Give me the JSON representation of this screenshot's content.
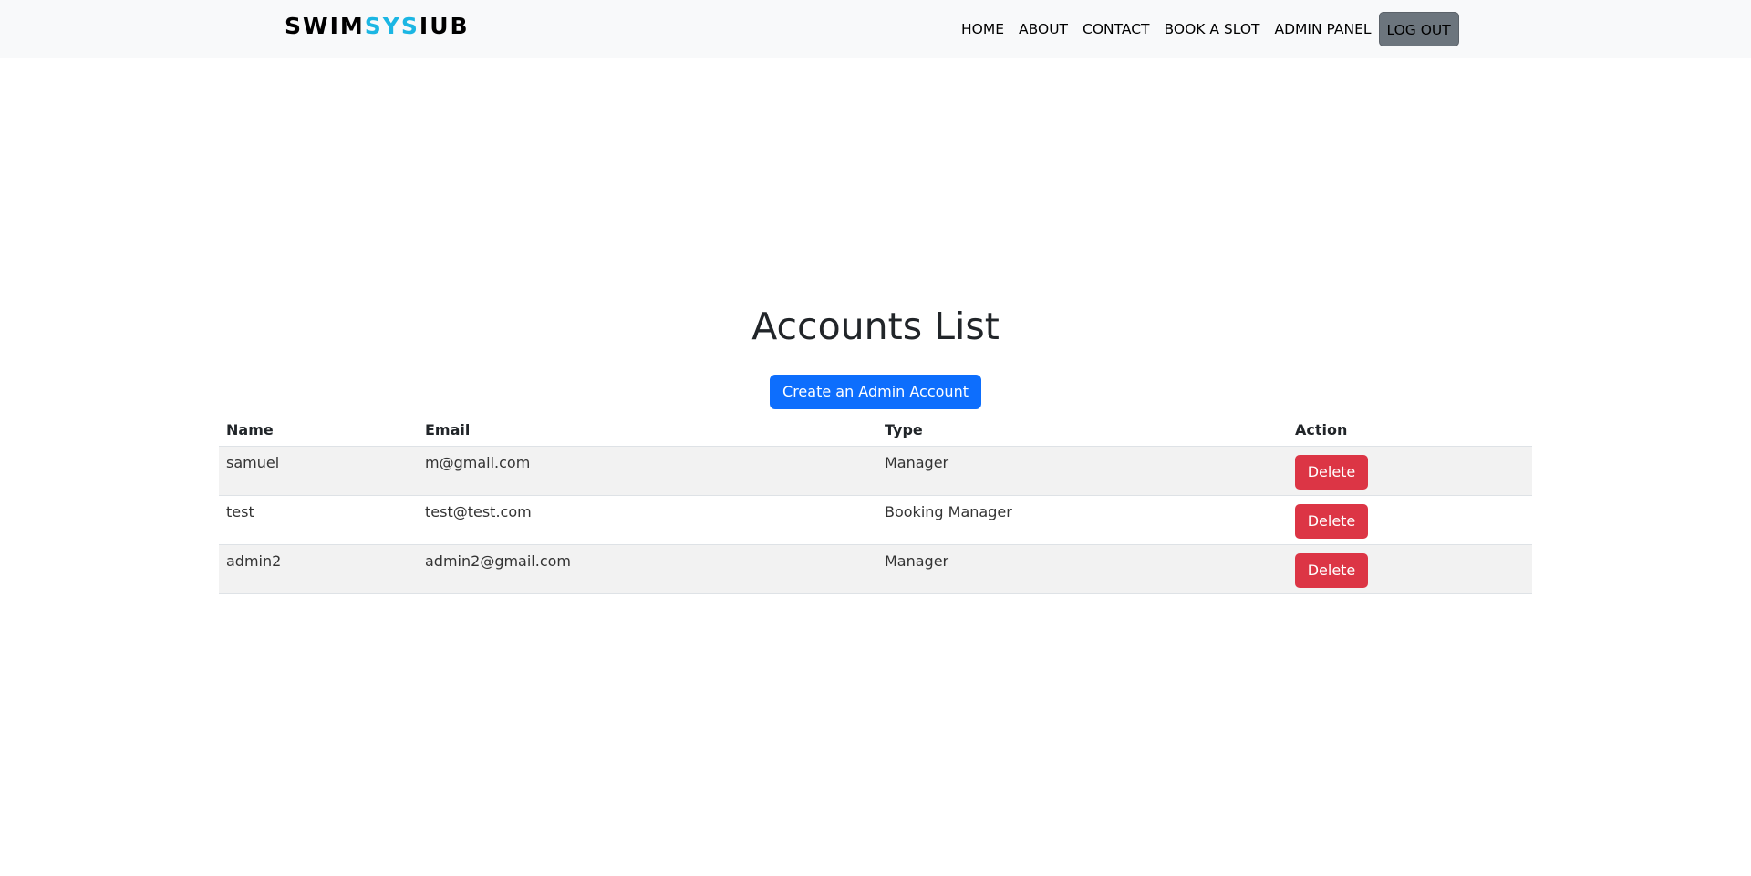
{
  "navbar": {
    "brand_part1": "SWIM",
    "brand_part2": "SYS",
    "brand_part3": "IUB",
    "brand_accent_color": "#1bb6e3",
    "links": [
      "HOME",
      "ABOUT",
      "CONTACT",
      "BOOK A SLOT",
      "ADMIN PANEL"
    ],
    "logout_label": "LOG OUT"
  },
  "main": {
    "title": "Accounts List",
    "create_button_label": "Create an Admin Account",
    "table": {
      "headers": [
        "Name",
        "Email",
        "Type",
        "Action"
      ],
      "rows": [
        {
          "name": "samuel",
          "email": "m@gmail.com",
          "type": "Manager",
          "action": "Delete"
        },
        {
          "name": "test",
          "email": "test@test.com",
          "type": "Booking Manager",
          "action": "Delete"
        },
        {
          "name": "admin2",
          "email": "admin2@gmail.com",
          "type": "Manager",
          "action": "Delete"
        }
      ]
    }
  },
  "colors": {
    "navbar_bg": "#f8f9fa",
    "primary": "#0d6efd",
    "danger": "#dc3545",
    "secondary": "#6c757d"
  }
}
